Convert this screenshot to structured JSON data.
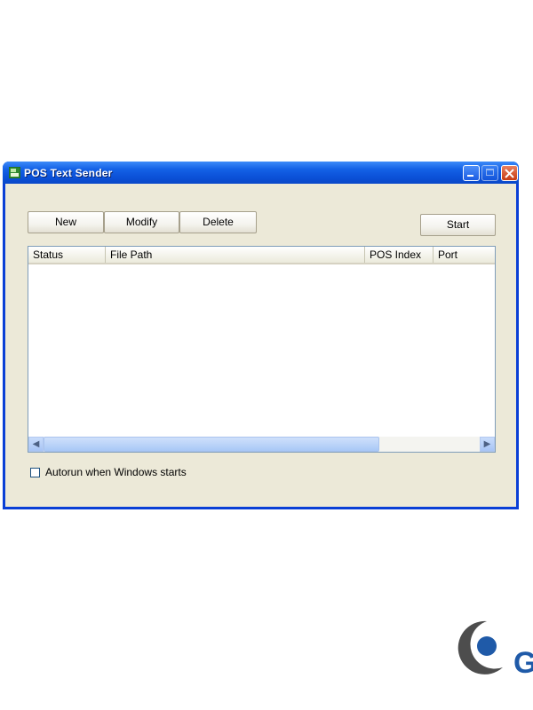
{
  "window": {
    "title": "POS Text Sender"
  },
  "toolbar": {
    "new_label": "New",
    "modify_label": "Modify",
    "delete_label": "Delete",
    "start_label": "Start"
  },
  "list": {
    "columns": [
      "Status",
      "File Path",
      "POS Index",
      "Port"
    ],
    "rows": []
  },
  "scrollbar": {
    "left_icon": "arrow-left-icon",
    "right_icon": "arrow-right-icon"
  },
  "options": {
    "autorun_label": "Autorun when Windows starts",
    "autorun_checked": false
  },
  "logo": {
    "text": "G"
  },
  "colors": {
    "titlebar": "#0b51d8",
    "client_bg": "#ece9d8",
    "close_button": "#c73b13",
    "logo_blue": "#1f5aa8",
    "logo_gray": "#4d4d4d"
  }
}
